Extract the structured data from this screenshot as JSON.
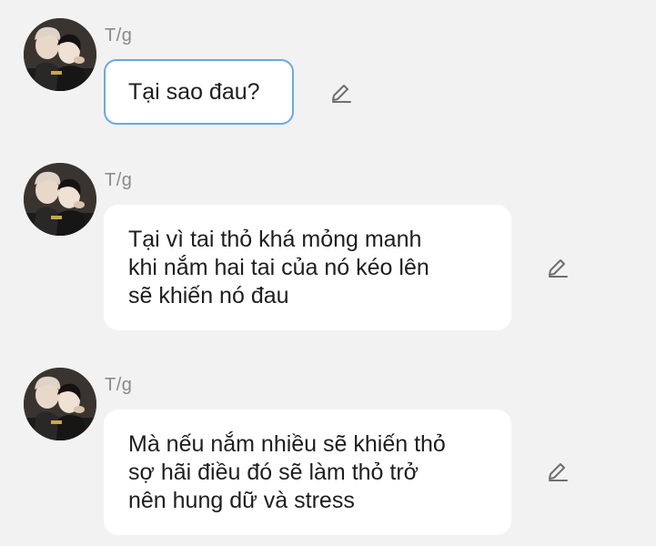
{
  "messages": [
    {
      "sender": "T/g",
      "lines": [
        "Tại sao đau?"
      ],
      "selected": true,
      "avatar_icon": "profile-photo-two-people",
      "action_icon": "pencil-icon"
    },
    {
      "sender": "T/g",
      "lines": [
        "Tại vì tai thỏ khá mỏng manh",
        "khi nắm hai tai của nó kéo lên",
        "sẽ khiến nó đau"
      ],
      "selected": false,
      "avatar_icon": "profile-photo-two-people",
      "action_icon": "pencil-icon"
    },
    {
      "sender": "T/g",
      "lines": [
        "Mà nếu nắm nhiều sẽ khiến thỏ",
        "sợ hãi điều đó sẽ làm thỏ trở",
        "nên hung dữ và stress"
      ],
      "selected": false,
      "avatar_icon": "profile-photo-two-people",
      "action_icon": "pencil-icon"
    }
  ],
  "colors": {
    "background": "#f2f2f2",
    "bubble": "#ffffff",
    "selected_border": "#6aa9e0",
    "sender_text": "#8a8a8a",
    "message_text": "#1e1e1e",
    "icon": "#6f6f6f"
  }
}
